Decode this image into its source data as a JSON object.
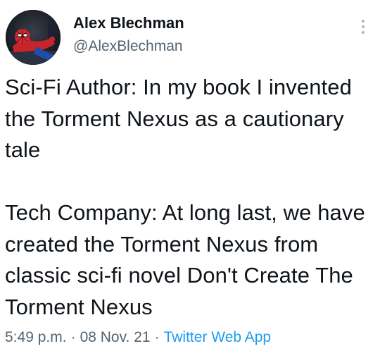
{
  "author": {
    "display_name": "Alex Blechman",
    "handle": "@AlexBlechman",
    "avatar_icon": "spiderman-avatar-icon"
  },
  "more_icon": "more-vertical-icon",
  "tweet": {
    "paragraphs": [
      "Sci-Fi Author: In my book I invented the Torment Nexus as a cautionary tale",
      "Tech Company: At long last, we have created the Torment Nexus from classic sci-fi novel Don't Create The Torment Nexus"
    ]
  },
  "meta": {
    "time": "5:49 p.m.",
    "separator": "·",
    "date": "08 Nov. 21",
    "source": "Twitter Web App"
  },
  "colors": {
    "text": "#0f1419",
    "secondary": "#536471",
    "link": "#1d9bf0"
  }
}
